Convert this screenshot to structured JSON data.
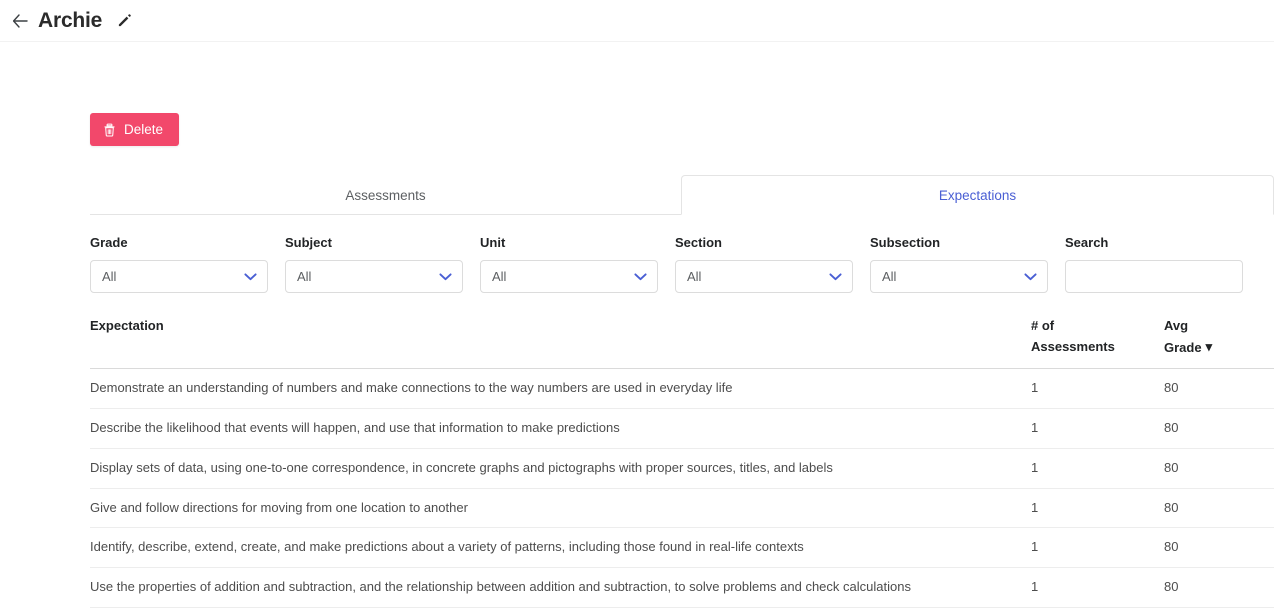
{
  "appbar": {
    "back_icon": "back-arrow-icon",
    "title": "Archie",
    "edit_icon": "pencil-icon"
  },
  "toolbar": {
    "delete_label": "Delete",
    "delete_icon": "trash-icon",
    "delete_color": "#f2486b"
  },
  "tabs": {
    "active_color": "#4a5fd4",
    "items": [
      {
        "label": "Assessments",
        "active": false
      },
      {
        "label": "Expectations",
        "active": true
      }
    ]
  },
  "filters": [
    {
      "label": "Grade",
      "value": "All"
    },
    {
      "label": "Subject",
      "value": "All"
    },
    {
      "label": "Unit",
      "value": "All"
    },
    {
      "label": "Section",
      "value": "All"
    },
    {
      "label": "Subsection",
      "value": "All"
    }
  ],
  "search": {
    "label": "Search",
    "value": "",
    "placeholder": ""
  },
  "table": {
    "headers": {
      "expectation": "Expectation",
      "num_assessments_line1": "# of",
      "num_assessments_line2": "Assessments",
      "avg_grade_line1": "Avg",
      "avg_grade_line2": "Grade",
      "sort_caret": "▾"
    },
    "rows": [
      {
        "expectation": "Demonstrate an understanding of numbers and make connections to the way numbers are used in everyday life",
        "num_assessments": "1",
        "avg_grade": "80"
      },
      {
        "expectation": "Describe the likelihood that events will happen, and use that information to make predictions",
        "num_assessments": "1",
        "avg_grade": "80"
      },
      {
        "expectation": "Display sets of data, using one-to-one correspondence, in concrete graphs and pictographs with proper sources, titles, and labels",
        "num_assessments": "1",
        "avg_grade": "80"
      },
      {
        "expectation": "Give and follow directions for moving from one location to another",
        "num_assessments": "1",
        "avg_grade": "80"
      },
      {
        "expectation": "Identify, describe, extend, create, and make predictions about a variety of patterns, including those found in real-life contexts",
        "num_assessments": "1",
        "avg_grade": "80"
      },
      {
        "expectation": "Use the properties of addition and subtraction, and the relationship between addition and subtraction, to solve problems and check calculations",
        "num_assessments": "1",
        "avg_grade": "80"
      }
    ]
  }
}
